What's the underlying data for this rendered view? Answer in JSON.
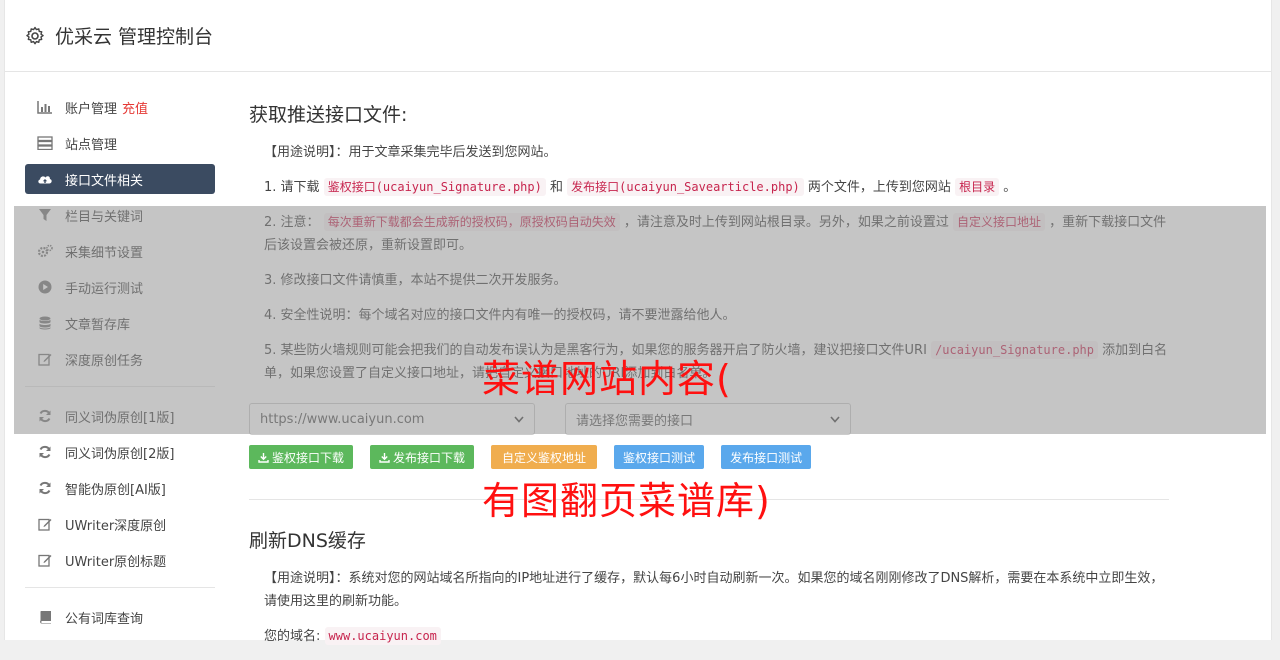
{
  "app": {
    "title": "优采云 管理控制台"
  },
  "sidebar": {
    "group1": [
      {
        "label": "账户管理",
        "extra": "充值",
        "icon": "bar-chart-icon"
      },
      {
        "label": "站点管理",
        "icon": "server-icon"
      },
      {
        "label": "接口文件相关",
        "icon": "cloud-upload-icon",
        "active": true
      },
      {
        "label": "栏目与关键词",
        "icon": "filter-icon"
      },
      {
        "label": "采集细节设置",
        "icon": "cogs-icon"
      },
      {
        "label": "手动运行测试",
        "icon": "play-circle-icon"
      },
      {
        "label": "文章暂存库",
        "icon": "database-icon"
      },
      {
        "label": "深度原创任务",
        "icon": "edit-icon"
      }
    ],
    "group2": [
      {
        "label": "同义词伪原创[1版]",
        "icon": "refresh-icon"
      },
      {
        "label": "同义词伪原创[2版]",
        "icon": "refresh-icon"
      },
      {
        "label": "智能伪原创[AI版]",
        "icon": "refresh-icon"
      },
      {
        "label": "UWriter深度原创",
        "icon": "edit-icon"
      },
      {
        "label": "UWriter原创标题",
        "icon": "edit-icon"
      }
    ],
    "group3": [
      {
        "label": "公有词库查询",
        "icon": "book-icon"
      }
    ]
  },
  "section1": {
    "title": "获取推送接口文件:",
    "usage": "【用途说明】：用于文章采集完毕后发送到您网站。",
    "step1": {
      "prefix": "1. 请下载",
      "code1": "鉴权接口(ucaiyun_Signature.php)",
      "and": "和",
      "code2": "发布接口(ucaiyun_Savearticle.php)",
      "mid": "两个文件，上传到您网站",
      "code3": "根目录",
      "suffix": "。"
    },
    "step2": {
      "prefix": "2. 注意：",
      "code1": "每次重新下载都会生成新的授权码，原授权码自动失效",
      "mid": "，请注意及时上传到网站根目录。另外，如果之前设置过",
      "code2": "自定义接口地址",
      "suffix": "，重新下载接口文件后该设置会被还原，重新设置即可。"
    },
    "step3": "3. 修改接口文件请慎重，本站不提供二次开发服务。",
    "step4": "4. 安全性说明：每个域名对应的接口文件内有唯一的授权码，请不要泄露给他人。",
    "step5": {
      "prefix": "5. 某些防火墙规则可能会把我们的自动发布误认为是黑客行为，如果您的服务器开启了防火墙，建议把接口文件URI",
      "code1": "/ucaiyun_Signature.php",
      "suffix": "添加到白名单，如果您设置了自定义接口地址，请把自定义接口地址的URI添加到白名单。"
    },
    "site_select": "https://www.ucaiyun.com",
    "interface_select_placeholder": "请选择您需要的接口",
    "buttons": {
      "auth_download": "鉴权接口下载",
      "publish_download": "发布接口下载",
      "custom_auth": "自定义鉴权地址",
      "auth_test": "鉴权接口测试",
      "publish_test": "发布接口测试"
    }
  },
  "section2": {
    "title": "刷新DNS缓存",
    "usage": "【用途说明】：系统对您的网站域名所指向的IP地址进行了缓存，默认每6小时自动刷新一次。如果您的域名刚刚修改了DNS解析，需要在本系统中立即生效，请使用这里的刷新功能。",
    "domain_label": "您的域名:",
    "domain_value": "www.ucaiyun.com"
  },
  "watermark": {
    "line1": "菜谱网站内容(",
    "line2": "有图翻页菜谱库)"
  }
}
